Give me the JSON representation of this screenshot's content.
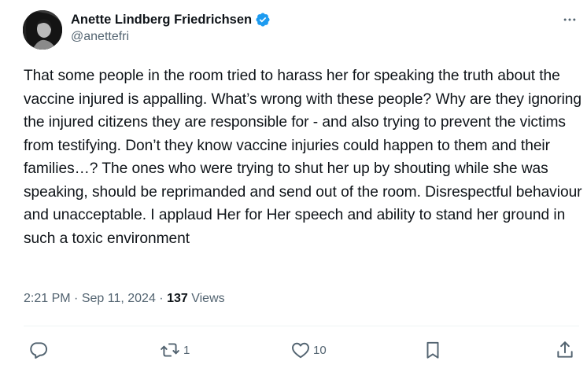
{
  "author": {
    "display_name": "Anette Lindberg Friedrichsen",
    "handle": "@anettefri",
    "verified": true
  },
  "post": {
    "text": "That some people in the room tried to harass her for speaking the truth about the vaccine injured is appalling. What’s wrong with these people? Why are they ignoring the injured citizens they are responsible for - and also trying to prevent the victims from testifying. Don’t they know vaccine injuries could happen to them and their families…? The ones who were trying to shut her up by shouting while she was speaking, should be reprimanded and send out of the room. Disrespectful behaviour and unacceptable. I applaud Her for Her speech and ability to stand her ground in such a toxic environment",
    "time": "2:21 PM",
    "separator": "·",
    "date": "Sep 11, 2024",
    "views_count": "137",
    "views_label": "Views"
  },
  "actions": {
    "reply_count": "",
    "repost_count": "1",
    "like_count": "10"
  },
  "icons": {
    "more": "more-horizontal-icon",
    "verified": "verified-badge-icon",
    "reply": "reply-icon",
    "repost": "repost-icon",
    "like": "like-icon",
    "bookmark": "bookmark-icon",
    "share": "share-icon"
  },
  "colors": {
    "text_primary": "#0f1419",
    "text_secondary": "#536471",
    "verified_blue": "#1d9bf0",
    "divider": "#eff3f4"
  }
}
